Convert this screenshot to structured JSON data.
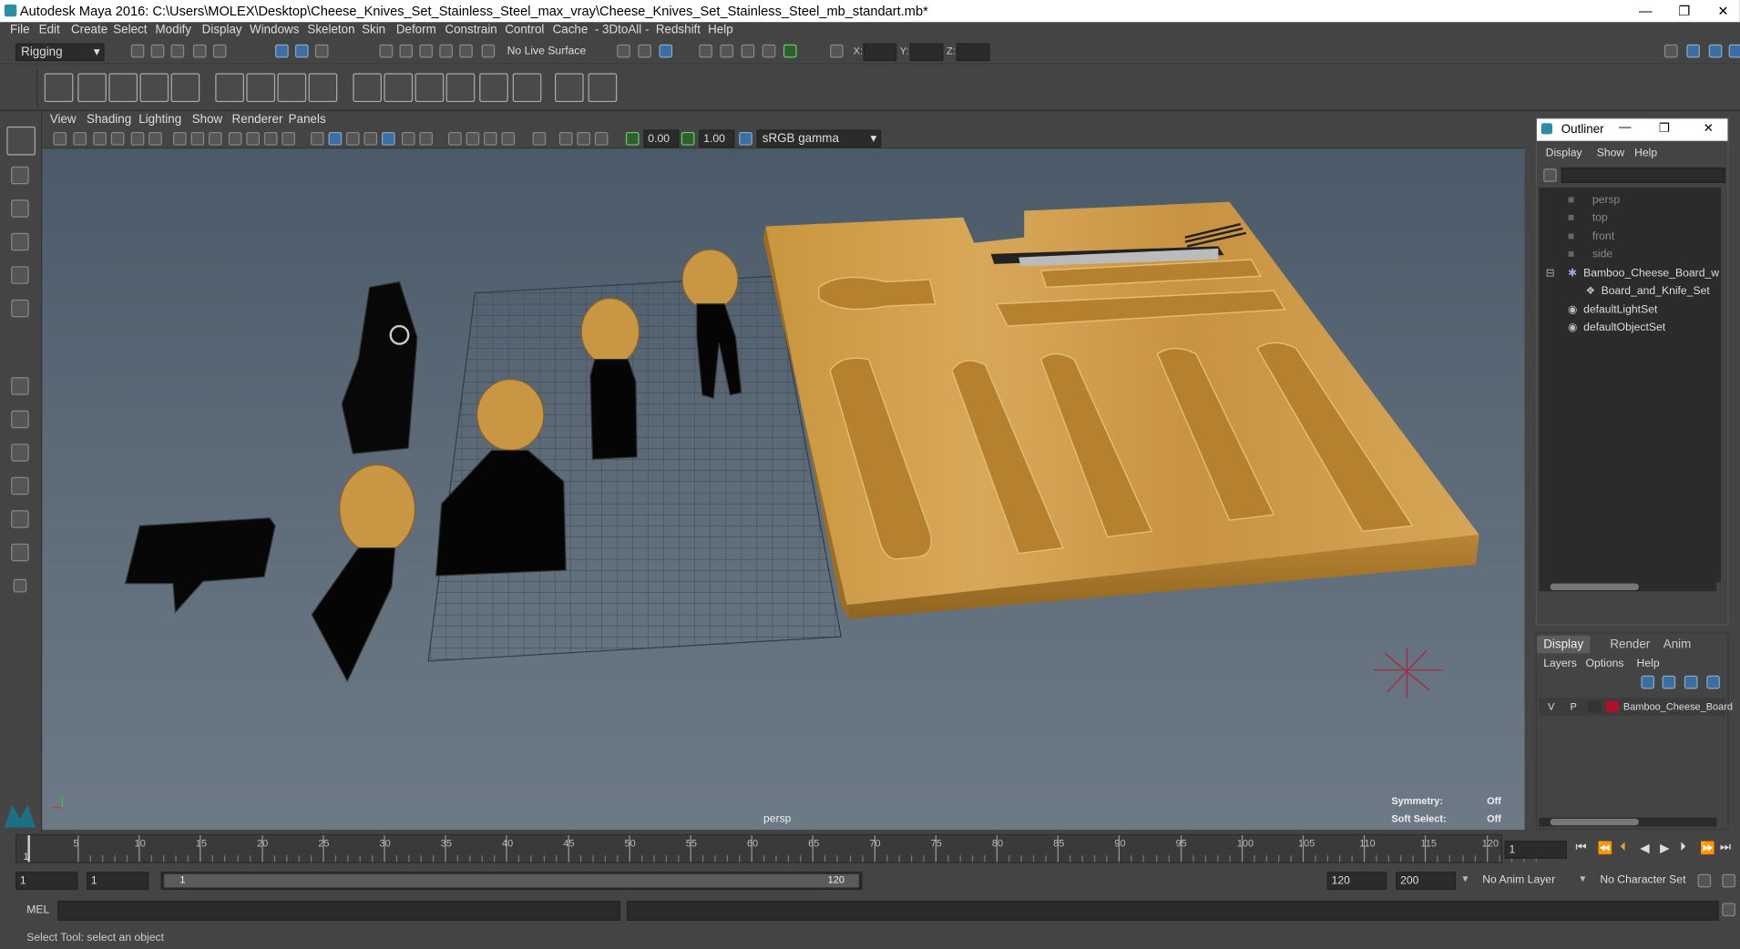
{
  "window": {
    "title": "Autodesk Maya 2016: C:\\Users\\MOLEX\\Desktop\\Cheese_Knives_Set_Stainless_Steel_max_vray\\Cheese_Knives_Set_Stainless_Steel_mb_standart.mb*",
    "minimize": "—",
    "restore": "❐",
    "close": "✕"
  },
  "menus": [
    "File",
    "Edit",
    "Create",
    "Select",
    "Modify",
    "Display",
    "Windows",
    "Skeleton",
    "Skin",
    "Deform",
    "Constrain",
    "Control",
    "Cache",
    "- 3DtoAll -",
    "Redshift",
    "Help"
  ],
  "statusline": {
    "menuset": "Rigging",
    "live_surface": "No Live Surface",
    "x_label": "X:",
    "y_label": "Y:",
    "z_label": "Z:"
  },
  "viewport": {
    "menus": [
      "View",
      "Shading",
      "Lighting",
      "Show",
      "Renderer",
      "Panels"
    ],
    "exposure": "0.00",
    "gamma": "1.00",
    "colorspace": "sRGB gamma",
    "camera_label": "persp",
    "symmetry_label": "Symmetry:",
    "symmetry_value": "Off",
    "softselect_label": "Soft Select:",
    "softselect_value": "Off"
  },
  "outliner": {
    "title": "Outliner",
    "menus": [
      "Display",
      "Show",
      "Help"
    ],
    "items": [
      {
        "label": "persp",
        "dim": true
      },
      {
        "label": "top",
        "dim": true
      },
      {
        "label": "front",
        "dim": true
      },
      {
        "label": "side",
        "dim": true
      },
      {
        "label": "Bamboo_Cheese_Board_w",
        "dim": false
      },
      {
        "label": "Board_and_Knife_Set",
        "dim": false
      },
      {
        "label": "defaultLightSet",
        "dim": false
      },
      {
        "label": "defaultObjectSet",
        "dim": false
      }
    ]
  },
  "layer_editor": {
    "tabs": [
      "Display",
      "Render",
      "Anim"
    ],
    "menus": [
      "Layers",
      "Options",
      "Help"
    ],
    "layer": {
      "v": "V",
      "p": "P",
      "name": "Bamboo_Cheese_Board",
      "color": "#b0102a"
    }
  },
  "timeline": {
    "ticks": [
      "5",
      "10",
      "15",
      "20",
      "25",
      "30",
      "35",
      "40",
      "45",
      "50",
      "55",
      "60",
      "65",
      "70",
      "75",
      "80",
      "85",
      "90",
      "95",
      "100",
      "105",
      "110",
      "115",
      "120"
    ],
    "start_marker": "1",
    "current_frame": "1"
  },
  "range": {
    "start": "1",
    "playback_start": "1",
    "slider_start": "1",
    "slider_end": "120",
    "playback_end": "120",
    "end": "200",
    "anim_layer": "No Anim Layer",
    "character_set": "No Character Set"
  },
  "mel": {
    "label": "MEL"
  },
  "status": {
    "help": "Select Tool: select an object"
  }
}
